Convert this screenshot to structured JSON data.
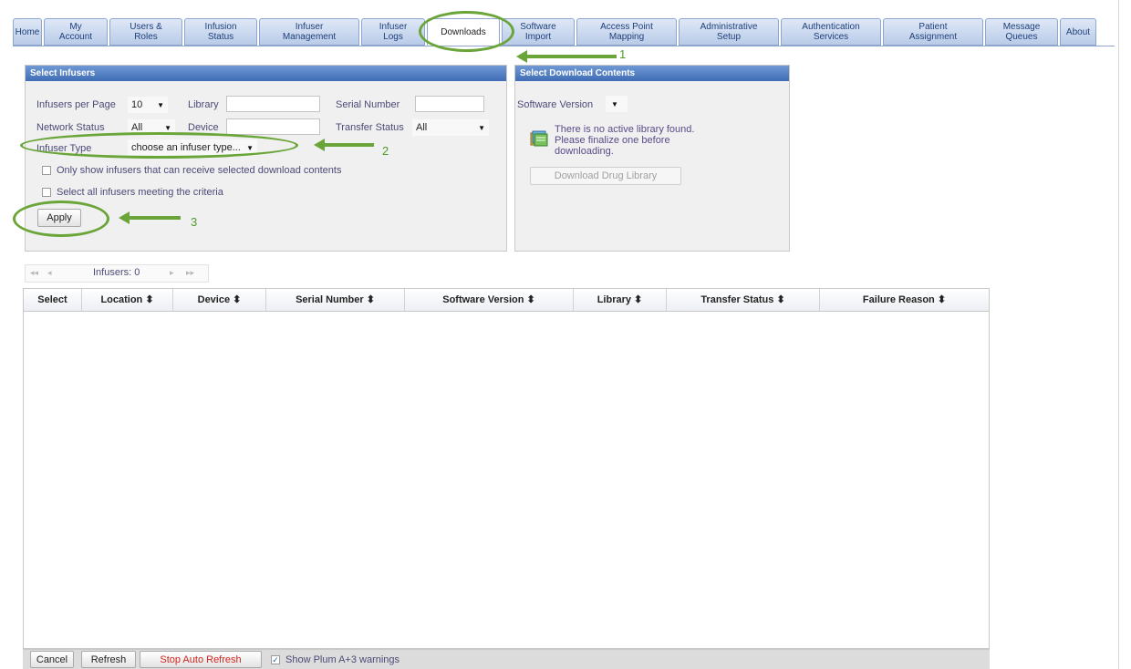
{
  "tabs": [
    {
      "label": "Home",
      "width": 32
    },
    {
      "label": "My\nAccount",
      "width": 70
    },
    {
      "label": "Users &\nRoles",
      "width": 80
    },
    {
      "label": "Infusion\nStatus",
      "width": 80
    },
    {
      "label": "Infuser\nManagement",
      "width": 110
    },
    {
      "label": "Infuser\nLogs",
      "width": 70
    },
    {
      "label": "Downloads",
      "width": 80,
      "active": true
    },
    {
      "label": "Software\nImport",
      "width": 80
    },
    {
      "label": "Access Point\nMapping",
      "width": 110
    },
    {
      "label": "Administrative\nSetup",
      "width": 110
    },
    {
      "label": "Authentication\nServices",
      "width": 110
    },
    {
      "label": "Patient\nAssignment",
      "width": 110
    },
    {
      "label": "Message\nQueues",
      "width": 80
    },
    {
      "label": "About",
      "width": 40
    }
  ],
  "select_infusers": {
    "title": "Select Infusers",
    "infusers_per_page_label": "Infusers per Page",
    "infusers_per_page_value": "10",
    "library_label": "Library",
    "serial_number_label": "Serial Number",
    "network_status_label": "Network Status",
    "network_status_value": "All",
    "device_label": "Device",
    "transfer_status_label": "Transfer Status",
    "transfer_status_value": "All",
    "infuser_type_label": "Infuser Type",
    "infuser_type_value": "choose an infuser type...",
    "only_show_label": "Only show infusers that can receive selected download contents",
    "select_all_label": "Select all infusers meeting the criteria",
    "apply_label": "Apply"
  },
  "download_contents": {
    "title": "Select Download Contents",
    "software_version_label": "Software Version",
    "message_line1": "There is no active library found.",
    "message_line2": "Please finalize one before",
    "message_line3": "downloading.",
    "download_button_label": "Download Drug Library"
  },
  "pager": {
    "first": "◂◂",
    "prev": "◂",
    "infusers_label": "Infusers: 0",
    "next": "▸",
    "last": "▸▸"
  },
  "table": {
    "columns": [
      {
        "label": "Select",
        "width": 64
      },
      {
        "label": "Location ⬍",
        "width": 100
      },
      {
        "label": "Device ⬍",
        "width": 102
      },
      {
        "label": "Serial Number ⬍",
        "width": 152
      },
      {
        "label": "Software Version ⬍",
        "width": 185
      },
      {
        "label": "Library ⬍",
        "width": 102
      },
      {
        "label": "Transfer Status ⬍",
        "width": 168
      },
      {
        "label": "Failure Reason ⬍",
        "width": 185
      }
    ]
  },
  "footer": {
    "cancel_label": "Cancel",
    "refresh_label": "Refresh",
    "stop_auto_refresh_label": "Stop Auto Refresh",
    "show_warnings_label": "Show Plum A+3 warnings",
    "show_warnings_checked": true
  },
  "annotations": {
    "step1": "1",
    "step2": "2",
    "step3": "3",
    "color": "#6aa53a"
  }
}
